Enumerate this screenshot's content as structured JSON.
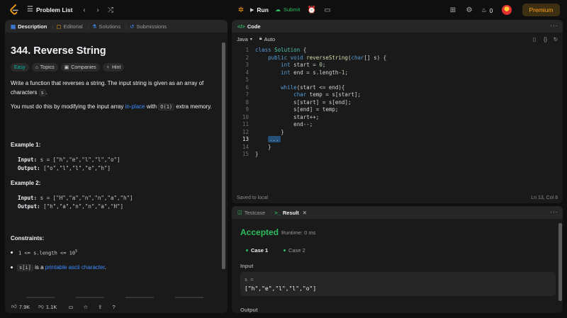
{
  "topbar": {
    "problem_list": "Problem List",
    "run": "Run",
    "submit": "Submit",
    "coins": "0",
    "premium": "Premium"
  },
  "left_tabs": [
    "Description",
    "Editorial",
    "Solutions",
    "Submissions"
  ],
  "problem": {
    "title": "344. Reverse String",
    "difficulty": "Easy",
    "chips": [
      "Topics",
      "Companies",
      "Hint"
    ],
    "p1a": "Write a function that reverses a string. The input string is given as an array of characters ",
    "p1_code": "s",
    "p1b": ".",
    "p2a": "You must do this by modifying the input array ",
    "p2_link": "in-place",
    "p2b": " with ",
    "p2_code": "O(1)",
    "p2c": " extra memory.",
    "examples": [
      {
        "head": "Example 1:",
        "input_label": "Input:",
        "input": "s = [\"h\",\"e\",\"l\",\"l\",\"o\"]",
        "output_label": "Output:",
        "output": "[\"o\",\"l\",\"l\",\"e\",\"h\"]"
      },
      {
        "head": "Example 2:",
        "input_label": "Input:",
        "input": "s = [\"H\",\"a\",\"n\",\"n\",\"a\",\"h\"]",
        "output_label": "Output:",
        "output": "[\"h\",\"a\",\"n\",\"n\",\"a\",\"H\"]"
      }
    ],
    "constraints_head": "Constraints:",
    "c1_code": "1 <= s.length <= 10",
    "c1_sup": "5",
    "c2_code": "s[i]",
    "c2a": " is a ",
    "c2_link": "printable ascii character",
    "c2b": "."
  },
  "left_footer": {
    "likes": "7.9K",
    "dislikes": "1.1K"
  },
  "code_panel": {
    "tab": "Code",
    "language": "Java",
    "mode": "Auto",
    "lines": [
      "class Solution {",
      "    public void reverseString(char[] s) {",
      "        int start = 0;",
      "        int end = s.length-1;",
      "",
      "        while(start <= end){",
      "            char temp = s[start];",
      "            s[start] = s[end];",
      "            s[end] = temp;",
      "            start++;",
      "            end--;",
      "        }",
      "    ...",
      "    }",
      "}"
    ],
    "saved": "Saved to local",
    "cursor": "Ln 13, Col 8"
  },
  "result_panel": {
    "tabs": [
      "Testcase",
      "Result"
    ],
    "status": "Accepted",
    "runtime": "Runtime: 0 ms",
    "cases": [
      "Case 1",
      "Case 2"
    ],
    "input_label": "Input",
    "var_name": "s =",
    "input_value": "[\"h\",\"e\",\"l\",\"l\",\"o\"]",
    "output_label": "Output"
  },
  "colors": {
    "accent": "#ffa116",
    "accepted": "#2cbb5d",
    "easy": "#00b8a3",
    "link": "#3e8bff"
  }
}
